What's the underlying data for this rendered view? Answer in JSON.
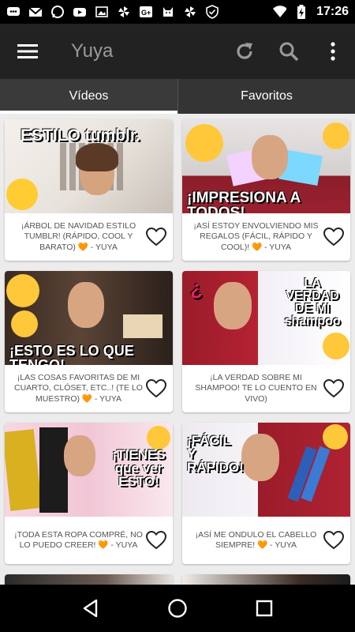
{
  "status_bar": {
    "time": "17:26",
    "left_icons": [
      "chat-icon",
      "gmail-icon",
      "whatsapp-icon",
      "youtube-icon",
      "image-icon",
      "pinwheel-icon",
      "google-plus-icon",
      "cat-icon",
      "pinwheel-icon",
      "shield-icon"
    ],
    "right_icons": [
      "wifi-icon",
      "battery-charging-icon"
    ]
  },
  "app_bar": {
    "title": "Yuya",
    "icons": [
      "menu-icon",
      "refresh-icon",
      "search-icon",
      "more-vert-icon"
    ]
  },
  "tabs": [
    {
      "label": "Vídeos",
      "active": true
    },
    {
      "label": "Favoritos",
      "active": false
    }
  ],
  "videos": [
    {
      "thumb_text": "ESTILO tumblr.",
      "title": "¡ÁRBOL DE NAVIDAD ESTILO TUMBLR! (RÁPIDO, COOL Y BARATO) 🧡 - Yuya"
    },
    {
      "thumb_text": "¡IMPRESIONA A TODOS!",
      "title": "¡ASÍ ESTOY ENVOLVIENDO MIS REGALOS (FÁCIL, RÁPIDO Y COOL)! 🧡 - Yuya"
    },
    {
      "thumb_text": "¡ESTO ES LO QUE TENGO!",
      "title": "¡LAS COSAS FAVORITAS DE MI CUARTO, CLÓSET, ETC..! (TE LO MUESTRO) 🧡 - Yuya"
    },
    {
      "thumb_text": "LA VERDAD DE MI shampoo",
      "title": "¡LA VERDAD SOBRE MI SHAMPOO! TE LO CUENTO EN VIVO)"
    },
    {
      "thumb_text": "¡TIENES que ver ESTO!",
      "title": "¡TODA ESTA ROPA COMPRÉ, NO LO PUEDO CREER! 🧡 - Yuya"
    },
    {
      "thumb_text": "¡FÁCIL Y RÁPIDO!",
      "title": "¡ASÍ ME ONDULO EL CABELLO SIEMPRE! 🧡 - Yuya"
    }
  ],
  "colors": {
    "app_bar": "#222222",
    "tabs": "#3a3a3a",
    "background": "#ececec"
  },
  "nav_bar": [
    "back-icon",
    "home-icon",
    "recents-icon"
  ]
}
